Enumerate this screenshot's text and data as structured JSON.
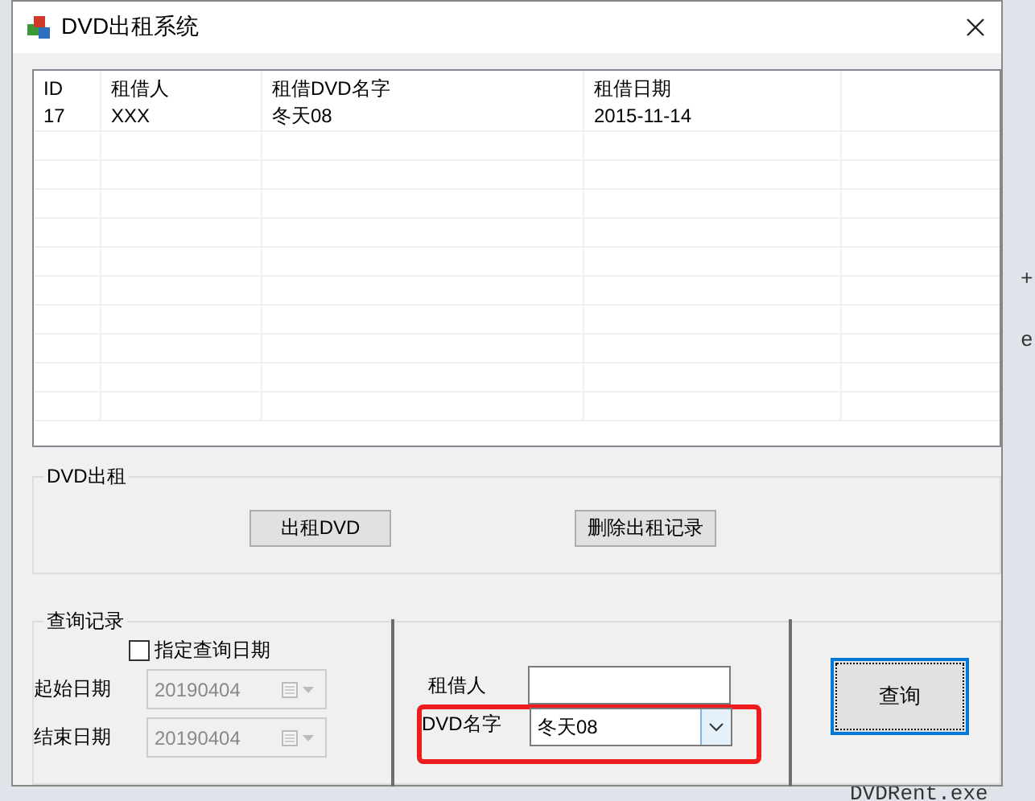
{
  "window": {
    "title": "DVD出租系统"
  },
  "table": {
    "columns": [
      "ID",
      "租借人",
      "租借DVD名字",
      "租借日期"
    ],
    "rows": [
      [
        "17",
        "XXX",
        "冬天08",
        "2015-11-14"
      ]
    ]
  },
  "rent_group": {
    "title": "DVD出租",
    "buttons": [
      "出租DVD",
      "删除出租记录"
    ]
  },
  "query_group": {
    "title": "查询记录",
    "date_filter": {
      "label": "指定查询日期",
      "checked": false
    },
    "dates": [
      {
        "label": "起始日期",
        "value": "20190404",
        "disabled": true
      },
      {
        "label": "结束日期",
        "value": "20190404",
        "disabled": true
      }
    ],
    "renter": {
      "label": "租借人"
    },
    "dvd_name": {
      "label": "DVD名字",
      "value": "冬天08",
      "highlighted": true
    },
    "button": "查询"
  },
  "background": {
    "texts": [
      "+",
      "e",
      "DVDRent.exe"
    ]
  }
}
